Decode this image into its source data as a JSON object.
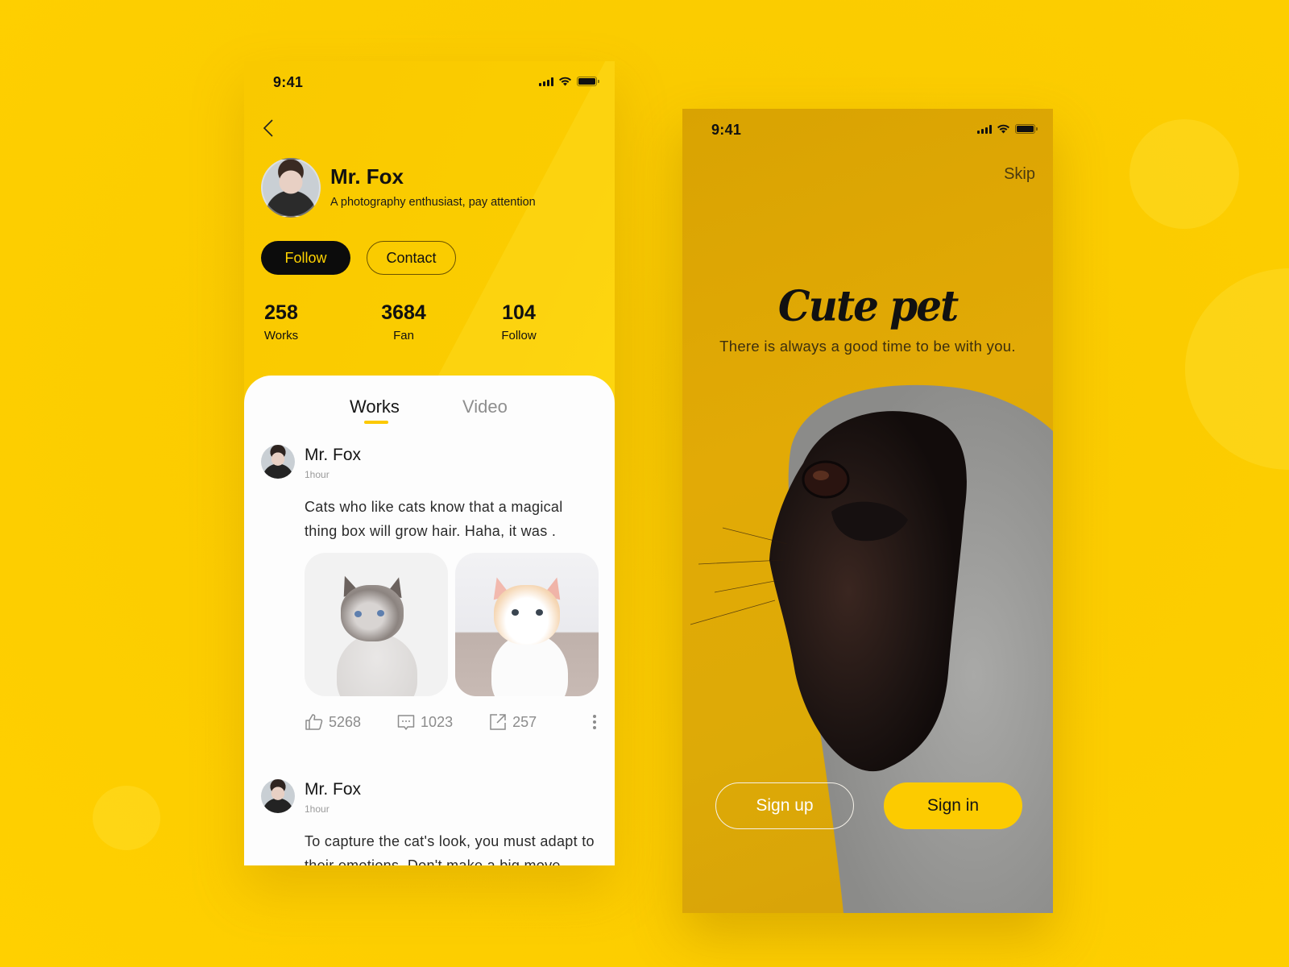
{
  "theme": {
    "background": "#fbcc00",
    "accent_yellow": "#fccb00",
    "follow_button_bg": "#0c0c0c",
    "follow_button_text": "#ffd200",
    "tab_indicator": "#fcc900",
    "muted_text": "#8c8c8c"
  },
  "profile_screen": {
    "status_bar": {
      "time": "9:41"
    },
    "back_icon": "chevron-left-icon",
    "profile": {
      "name": "Mr. Fox",
      "bio": "A photography enthusiast, pay attention"
    },
    "buttons": {
      "follow": "Follow",
      "contact": "Contact"
    },
    "stats": [
      {
        "value": "258",
        "label": "Works"
      },
      {
        "value": "3684",
        "label": "Fan"
      },
      {
        "value": "104",
        "label": "Follow"
      }
    ],
    "tabs": [
      {
        "label": "Works",
        "active": true
      },
      {
        "label": "Video",
        "active": false
      }
    ],
    "posts": [
      {
        "author": "Mr. Fox",
        "time": "1hour",
        "text": "Cats who like cats know that a magical thing box will grow hair. Haha, it was .",
        "images": [
          "cat-ragdoll-photo",
          "kitten-calico-photo"
        ],
        "actions": {
          "likes": "5268",
          "comments": "1023",
          "shares": "257"
        }
      },
      {
        "author": "Mr. Fox",
        "time": "1hour",
        "text": "To capture the cat's look, you must adapt to their emotions. Don't make a big move"
      }
    ]
  },
  "splash_screen": {
    "status_bar": {
      "time": "9:41"
    },
    "skip": "Skip",
    "title": "Cute pet",
    "subtitle": "There is always a good time to be with you.",
    "buttons": {
      "sign_up": "Sign up",
      "sign_in": "Sign in"
    }
  }
}
